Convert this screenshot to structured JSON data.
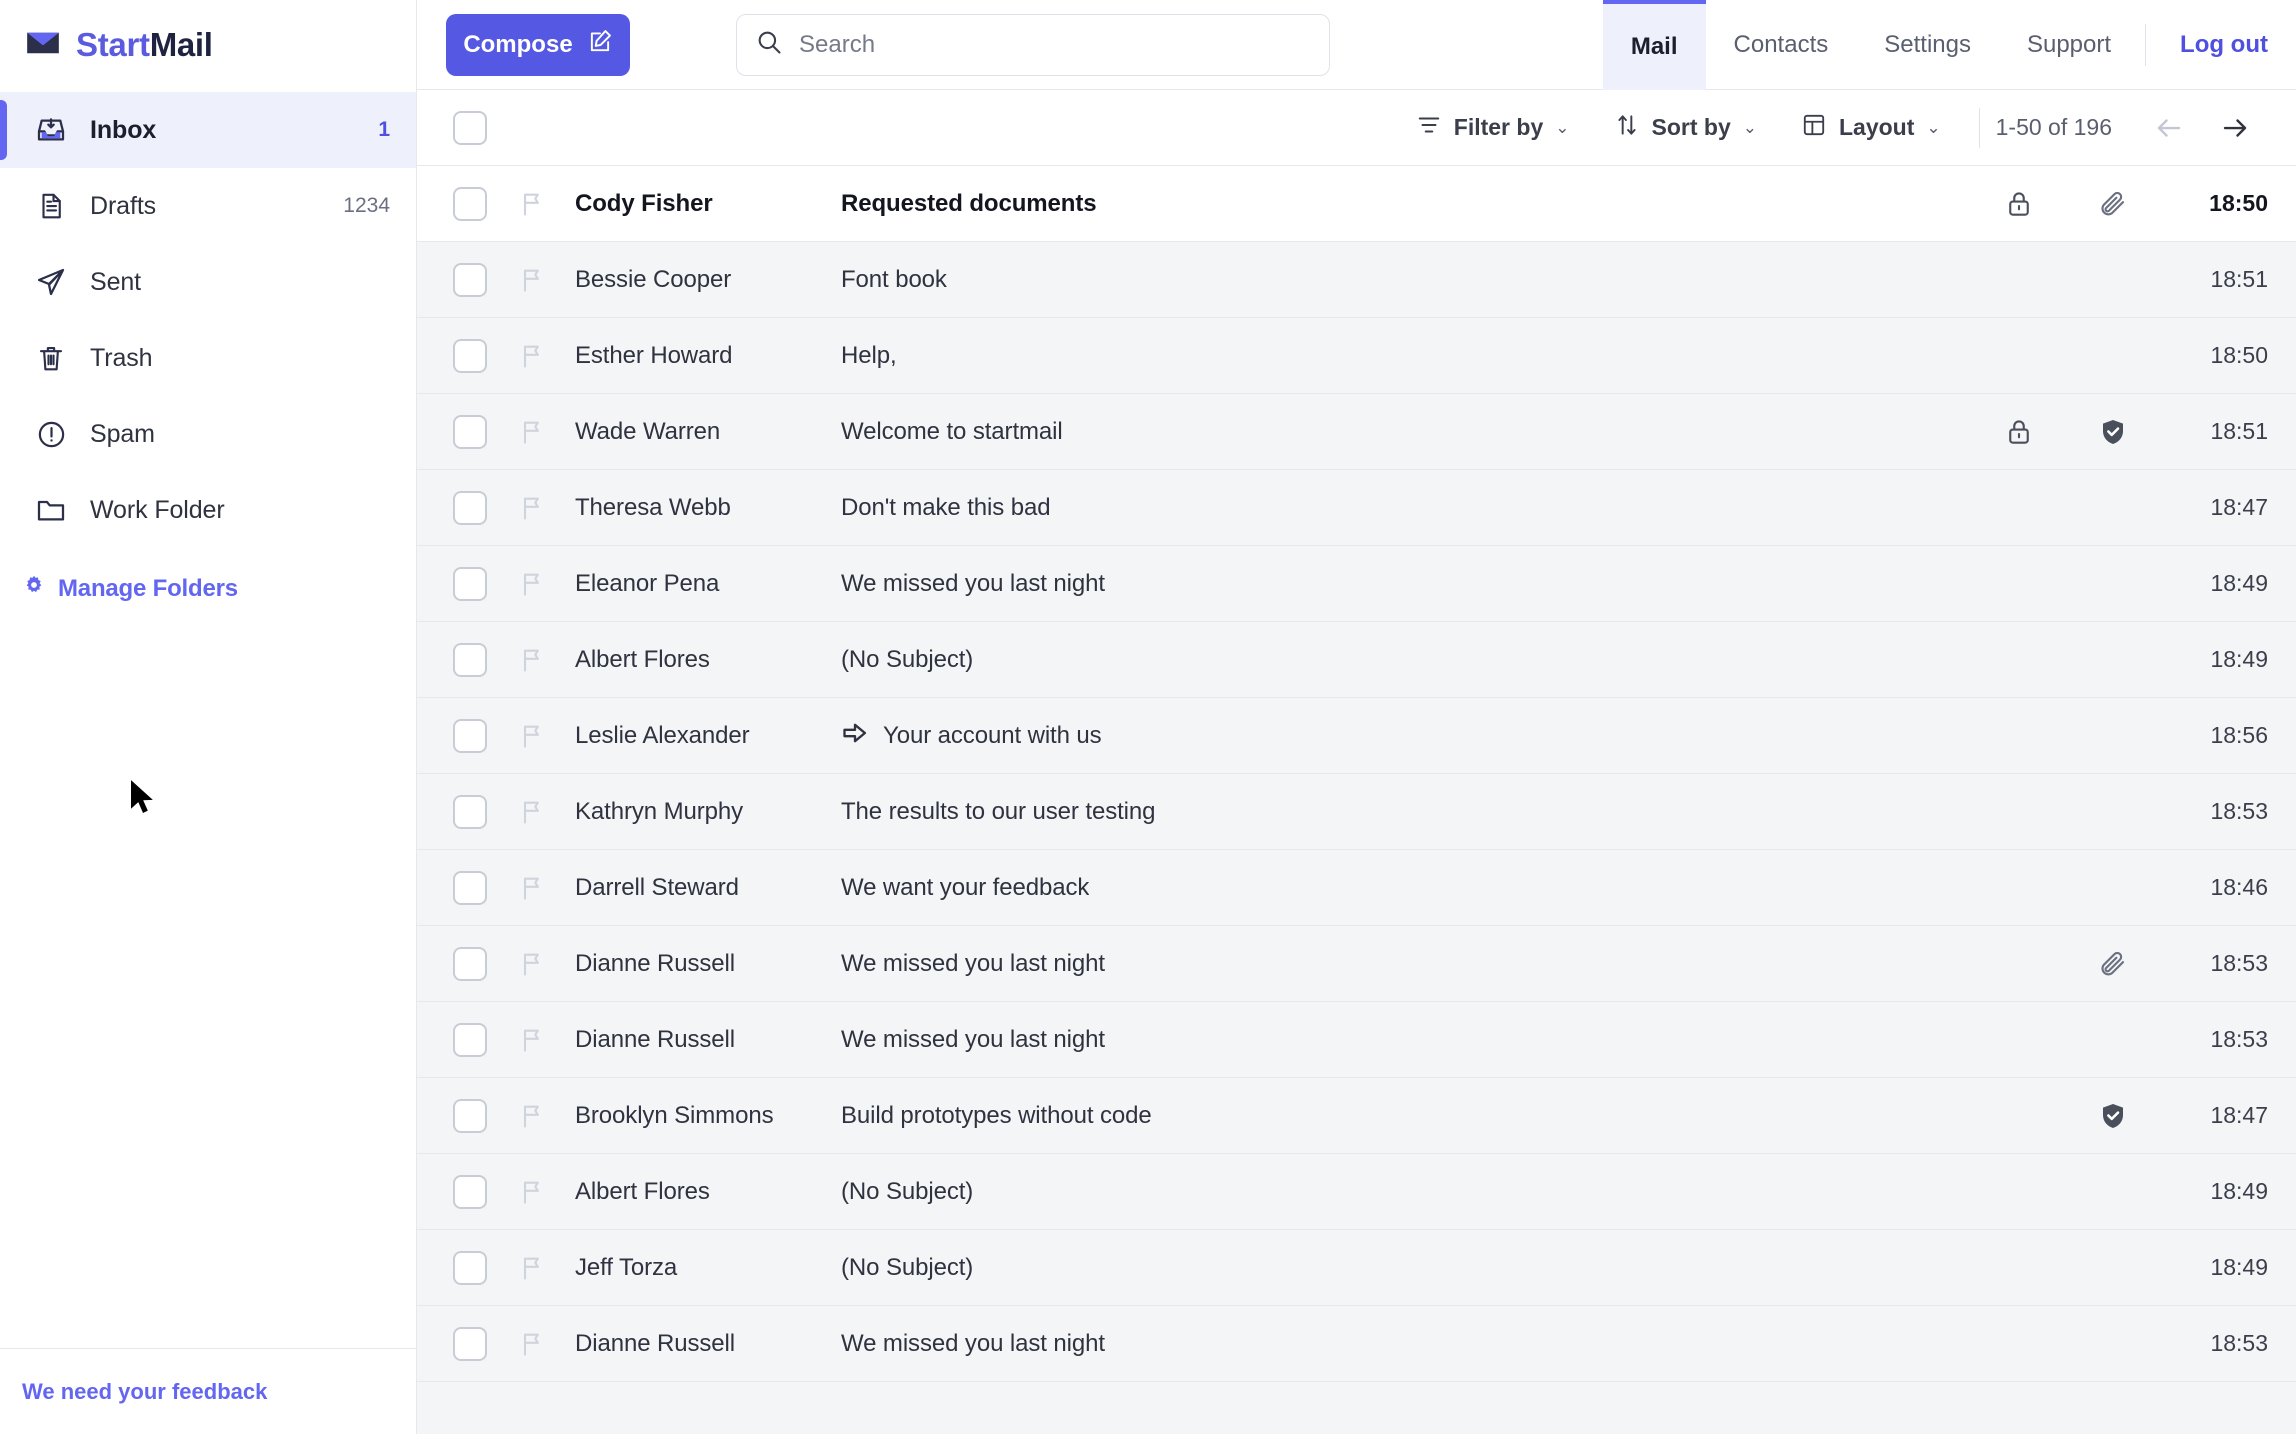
{
  "brand": {
    "part1": "Start",
    "part2": "Mail",
    "icon": "envelope-icon"
  },
  "sidebar": {
    "items": [
      {
        "label": "Inbox",
        "count": "1",
        "icon": "inbox-icon",
        "active": true
      },
      {
        "label": "Drafts",
        "count": "1234",
        "icon": "document-icon",
        "active": false
      },
      {
        "label": "Sent",
        "count": "",
        "icon": "paper-plane-icon",
        "active": false
      },
      {
        "label": "Trash",
        "count": "",
        "icon": "trash-icon",
        "active": false
      },
      {
        "label": "Spam",
        "count": "",
        "icon": "alert-circle-icon",
        "active": false
      },
      {
        "label": "Work Folder",
        "count": "",
        "icon": "folder-icon",
        "active": false
      }
    ],
    "manage_folders": "Manage Folders",
    "manage_folders_icon": "gear-icon",
    "feedback": "We need your feedback"
  },
  "topbar": {
    "compose_label": "Compose",
    "compose_icon": "compose-pencil-icon",
    "search_placeholder": "Search",
    "search_value": "",
    "search_icon": "search-icon",
    "nav": [
      {
        "label": "Mail",
        "active": true
      },
      {
        "label": "Contacts",
        "active": false
      },
      {
        "label": "Settings",
        "active": false
      },
      {
        "label": "Support",
        "active": false
      }
    ],
    "logout_label": "Log out"
  },
  "toolbar": {
    "filter_label": "Filter by",
    "filter_icon": "filter-icon",
    "sort_label": "Sort by",
    "sort_icon": "sort-arrows-icon",
    "layout_label": "Layout",
    "layout_icon": "layout-grid-icon",
    "chevron": "⌄",
    "pagination": "1-50 of 196",
    "prev_icon": "arrow-left-icon",
    "next_icon": "arrow-right-icon"
  },
  "colors": {
    "accent": "#6366f1",
    "compose_bg": "#5558e3",
    "link": "#4f4fe0",
    "row_alt_bg": "#f4f5f7",
    "active_folder_bg": "#eef1fb"
  },
  "emails": [
    {
      "sender": "Cody Fisher",
      "subject": "Requested documents",
      "time": "18:50",
      "unread": true,
      "lock": true,
      "attachment": true,
      "verified": false,
      "forwarded": false
    },
    {
      "sender": "Bessie Cooper",
      "subject": "Font book",
      "time": "18:51",
      "unread": false,
      "lock": false,
      "attachment": false,
      "verified": false,
      "forwarded": false
    },
    {
      "sender": "Esther Howard",
      "subject": "Help,",
      "time": "18:50",
      "unread": false,
      "lock": false,
      "attachment": false,
      "verified": false,
      "forwarded": false
    },
    {
      "sender": "Wade Warren",
      "subject": "Welcome to startmail",
      "time": "18:51",
      "unread": false,
      "lock": true,
      "attachment": false,
      "verified": true,
      "forwarded": false
    },
    {
      "sender": "Theresa Webb",
      "subject": "Don't make this bad",
      "time": "18:47",
      "unread": false,
      "lock": false,
      "attachment": false,
      "verified": false,
      "forwarded": false
    },
    {
      "sender": "Eleanor Pena",
      "subject": "We missed you last night",
      "time": "18:49",
      "unread": false,
      "lock": false,
      "attachment": false,
      "verified": false,
      "forwarded": false
    },
    {
      "sender": "Albert Flores",
      "subject": "(No Subject)",
      "time": "18:49",
      "unread": false,
      "lock": false,
      "attachment": false,
      "verified": false,
      "forwarded": false
    },
    {
      "sender": "Leslie Alexander",
      "subject": "Your account with us",
      "time": "18:56",
      "unread": false,
      "lock": false,
      "attachment": false,
      "verified": false,
      "forwarded": true
    },
    {
      "sender": "Kathryn Murphy",
      "subject": "The results to our user testing",
      "time": "18:53",
      "unread": false,
      "lock": false,
      "attachment": false,
      "verified": false,
      "forwarded": false
    },
    {
      "sender": "Darrell Steward",
      "subject": "We want your feedback",
      "time": "18:46",
      "unread": false,
      "lock": false,
      "attachment": false,
      "verified": false,
      "forwarded": false
    },
    {
      "sender": "Dianne Russell",
      "subject": "We missed you last night",
      "time": "18:53",
      "unread": false,
      "lock": false,
      "attachment": true,
      "verified": false,
      "forwarded": false
    },
    {
      "sender": "Dianne Russell",
      "subject": "We missed you last night",
      "time": "18:53",
      "unread": false,
      "lock": false,
      "attachment": false,
      "verified": false,
      "forwarded": false
    },
    {
      "sender": "Brooklyn Simmons",
      "subject": "Build prototypes without code",
      "time": "18:47",
      "unread": false,
      "lock": false,
      "attachment": false,
      "verified": true,
      "forwarded": false
    },
    {
      "sender": "Albert Flores",
      "subject": "(No Subject)",
      "time": "18:49",
      "unread": false,
      "lock": false,
      "attachment": false,
      "verified": false,
      "forwarded": false
    },
    {
      "sender": "Jeff Torza",
      "subject": "(No Subject)",
      "time": "18:49",
      "unread": false,
      "lock": false,
      "attachment": false,
      "verified": false,
      "forwarded": false
    },
    {
      "sender": "Dianne Russell",
      "subject": "We missed you last night",
      "time": "18:53",
      "unread": false,
      "lock": false,
      "attachment": false,
      "verified": false,
      "forwarded": false
    }
  ]
}
